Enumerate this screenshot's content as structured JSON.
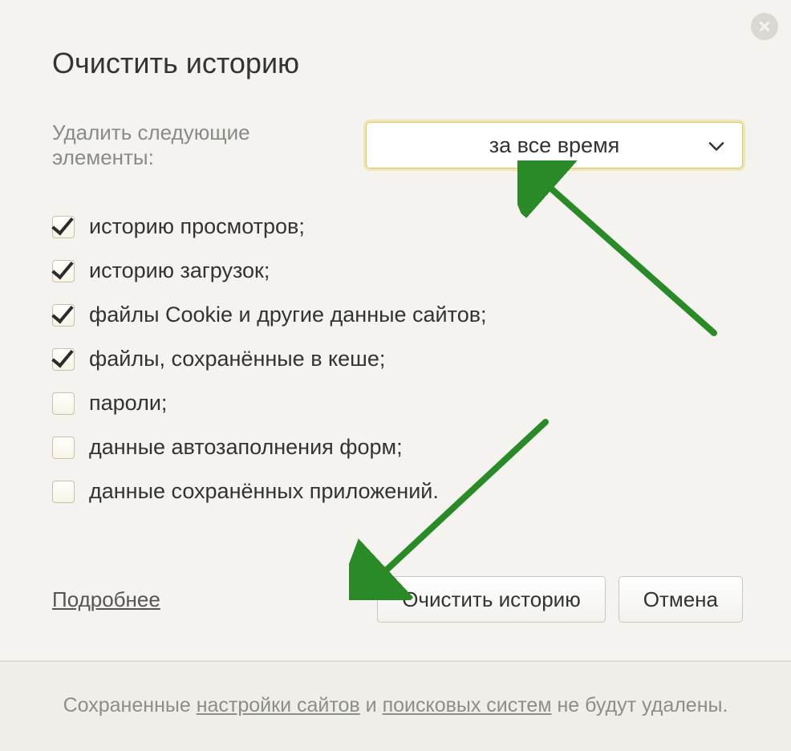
{
  "title": "Очистить историю",
  "selectRow": {
    "label": "Удалить следующие элементы:",
    "selected": "за все время"
  },
  "items": [
    {
      "label": "историю просмотров;",
      "checked": true
    },
    {
      "label": "историю загрузок;",
      "checked": true
    },
    {
      "label": "файлы Cookie и другие данные сайтов;",
      "checked": true
    },
    {
      "label": "файлы, сохранённые в кеше;",
      "checked": true
    },
    {
      "label": "пароли;",
      "checked": false
    },
    {
      "label": "данные автозаполнения форм;",
      "checked": false
    },
    {
      "label": "данные сохранённых приложений.",
      "checked": false
    }
  ],
  "moreLink": "Подробнее",
  "buttons": {
    "clear": "Очистить историю",
    "cancel": "Отмена"
  },
  "footnote": {
    "pre": "Сохраненные ",
    "link1": "настройки сайтов",
    "mid": " и ",
    "link2": "поисковых систем",
    "post": " не будут удалены."
  }
}
